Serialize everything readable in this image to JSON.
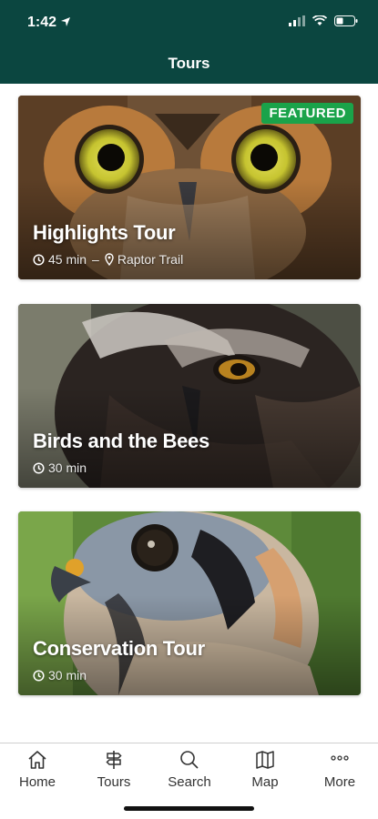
{
  "status_bar": {
    "time": "1:42"
  },
  "nav": {
    "title": "Tours"
  },
  "tours": [
    {
      "title": "Highlights Tour",
      "duration": "45 min",
      "location": "Raptor Trail",
      "badge": "FEATURED"
    },
    {
      "title": "Birds and the Bees",
      "duration": "30 min"
    },
    {
      "title": "Conservation Tour",
      "duration": "30 min"
    }
  ],
  "tabbar": {
    "items": [
      {
        "label": "Home",
        "icon": "home-icon"
      },
      {
        "label": "Tours",
        "icon": "signpost-icon"
      },
      {
        "label": "Search",
        "icon": "search-icon"
      },
      {
        "label": "Map",
        "icon": "map-icon"
      },
      {
        "label": "More",
        "icon": "more-icon"
      }
    ]
  },
  "colors": {
    "header": "#0b4640",
    "badge": "#1aa34a"
  }
}
